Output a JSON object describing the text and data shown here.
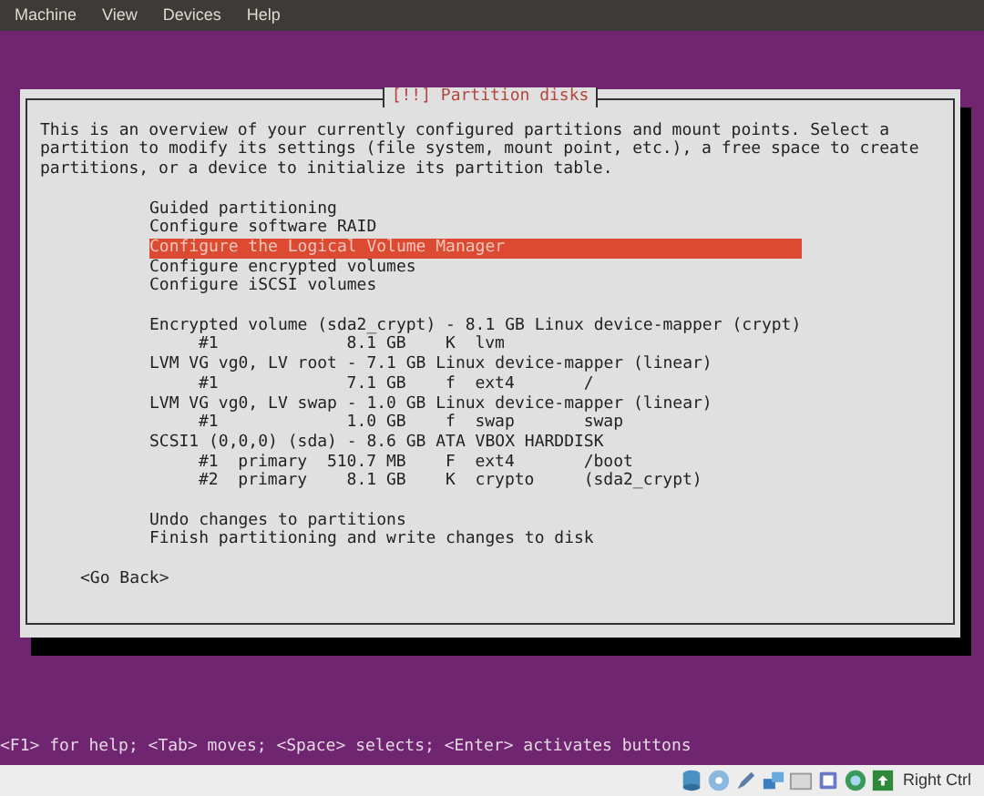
{
  "menu_bar": [
    "Machine",
    "View",
    "Devices",
    "Help"
  ],
  "dialog": {
    "title": "[!!] Partition disks",
    "intro": [
      "This is an overview of your currently configured partitions and mount points. Select a",
      "partition to modify its settings (file system, mount point, etc.), a free space to create",
      "partitions, or a device to initialize its partition table."
    ],
    "options": [
      {
        "label": "Guided partitioning",
        "selected": false
      },
      {
        "label": "Configure software RAID",
        "selected": false
      },
      {
        "label": "Configure the Logical Volume Manager",
        "selected": true
      },
      {
        "label": "Configure encrypted volumes",
        "selected": false
      },
      {
        "label": "Configure iSCSI volumes",
        "selected": false
      }
    ],
    "devices": [
      {
        "label": "Encrypted volume (sda2_crypt) - 8.1 GB Linux device-mapper (crypt)",
        "kind": "device"
      },
      {
        "label": "#1             8.1 GB    K  lvm",
        "kind": "partition"
      },
      {
        "label": "LVM VG vg0, LV root - 7.1 GB Linux device-mapper (linear)",
        "kind": "device"
      },
      {
        "label": "#1             7.1 GB    f  ext4       /",
        "kind": "partition"
      },
      {
        "label": "LVM VG vg0, LV swap - 1.0 GB Linux device-mapper (linear)",
        "kind": "device"
      },
      {
        "label": "#1             1.0 GB    f  swap       swap",
        "kind": "partition"
      },
      {
        "label": "SCSI1 (0,0,0) (sda) - 8.6 GB ATA VBOX HARDDISK",
        "kind": "device"
      },
      {
        "label": "#1  primary  510.7 MB    F  ext4       /boot",
        "kind": "partition"
      },
      {
        "label": "#2  primary    8.1 GB    K  crypto     (sda2_crypt)",
        "kind": "partition"
      }
    ],
    "actions": [
      "Undo changes to partitions",
      "Finish partitioning and write changes to disk"
    ],
    "button": "<Go Back>"
  },
  "help_line": "<F1> for help; <Tab> moves; <Space> selects; <Enter> activates buttons",
  "status_bar": {
    "host_key": "Right Ctrl"
  }
}
